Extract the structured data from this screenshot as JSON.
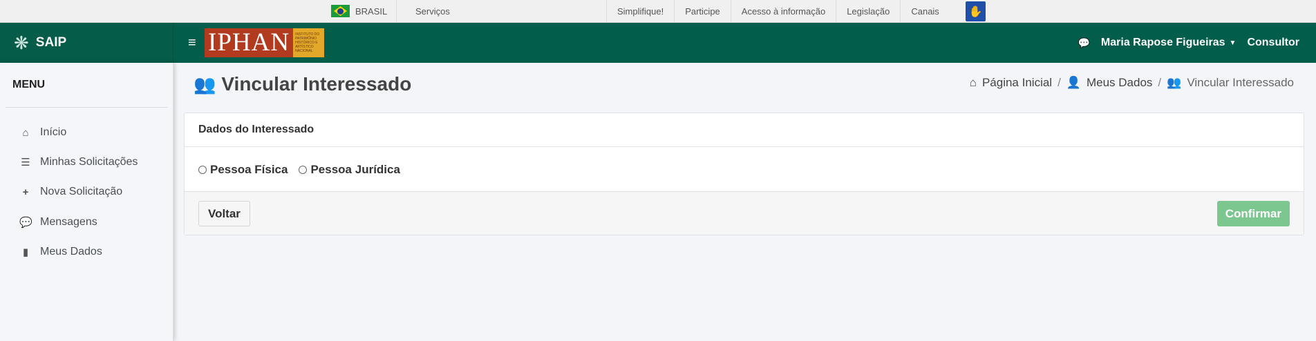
{
  "govbar": {
    "country": "BRASIL",
    "servicos": "Serviços",
    "links": [
      "Simplifique!",
      "Participe",
      "Acesso à informação",
      "Legislação",
      "Canais"
    ]
  },
  "header": {
    "app_name": "SAIP",
    "logo_text": "IPHAN",
    "logo_subtext": "INSTITUTO DO PATRIMÔNIO HISTÓRICO E ARTÍSTICO NACIONAL",
    "user_name": "Maria Rapose Figueiras",
    "role": "Consultor",
    "brand_color": "#025e4a"
  },
  "sidebar": {
    "title": "MENU",
    "items": [
      {
        "label": "Início",
        "icon": "home-icon"
      },
      {
        "label": "Minhas Solicitações",
        "icon": "list-icon"
      },
      {
        "label": "Nova Solicitação",
        "icon": "plus-icon"
      },
      {
        "label": "Mensagens",
        "icon": "comments-icon"
      },
      {
        "label": "Meus Dados",
        "icon": "file-icon"
      }
    ]
  },
  "page": {
    "title": "Vincular Interessado",
    "breadcrumb": [
      "Página Inicial",
      "Meus Dados",
      "Vincular Interessado"
    ]
  },
  "card": {
    "header": "Dados do Interessado",
    "options": [
      "Pessoa Física",
      "Pessoa Jurídica"
    ],
    "back_label": "Voltar",
    "confirm_label": "Confirmar"
  }
}
